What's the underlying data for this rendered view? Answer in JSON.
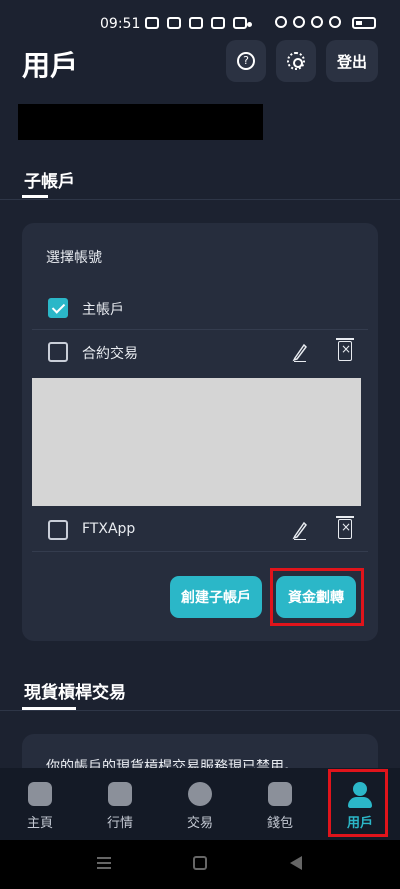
{
  "status_bar": {
    "time": "09:51"
  },
  "header": {
    "title": "用戶",
    "logout_label": "登出"
  },
  "section1": {
    "title": "子帳戶"
  },
  "card": {
    "label": "選擇帳號",
    "rows": [
      {
        "label": "主帳戶",
        "checked": true
      },
      {
        "label": "合約交易",
        "checked": false
      },
      {
        "label": "FTXApp",
        "checked": false
      }
    ],
    "create_button": "創建子帳戶",
    "transfer_button": "資金劃轉"
  },
  "section2": {
    "title": "現貨槓桿交易"
  },
  "notice": {
    "text": "你的帳戶的現貨槓桿交易服務現已禁用。"
  },
  "nav": [
    {
      "label": "主頁",
      "icon": "home-icon"
    },
    {
      "label": "行情",
      "icon": "chart-icon"
    },
    {
      "label": "交易",
      "icon": "exchange-icon"
    },
    {
      "label": "錢包",
      "icon": "wallet-icon"
    },
    {
      "label": "用戶",
      "icon": "user-icon",
      "active": true
    }
  ],
  "colors": {
    "accent": "#2bb7c8",
    "highlight": "#e0141b",
    "background": "#1c2230"
  }
}
